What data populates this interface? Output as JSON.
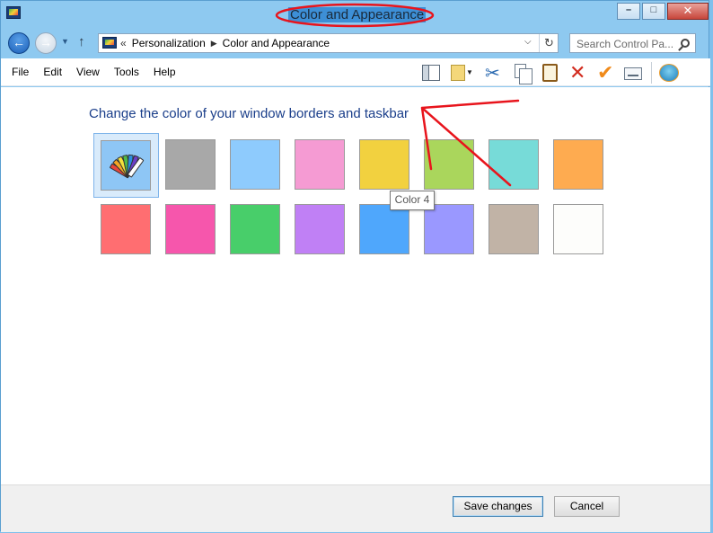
{
  "window": {
    "title": "Color and Appearance",
    "caption_buttons": {
      "minimize": "–",
      "maximize": "□",
      "close": "✕"
    }
  },
  "address_bar": {
    "back_glyph": "←",
    "forward_glyph": "→",
    "up_glyph": "↑",
    "overflow": "«",
    "breadcrumbs": [
      "Personalization",
      "Color and Appearance"
    ],
    "search_placeholder": "Search Control Pa..."
  },
  "menu": {
    "items": [
      "File",
      "Edit",
      "View",
      "Tools",
      "Help"
    ]
  },
  "toolbar": {
    "icons": [
      "preview-pane-icon",
      "organize-icon",
      "cut-icon",
      "copy-icon",
      "paste-icon",
      "delete-icon",
      "check-icon",
      "properties-icon",
      "theme-icon"
    ]
  },
  "content": {
    "heading": "Change the color of your window borders and taskbar",
    "tooltip": "Color 4",
    "swatches": [
      {
        "color": "#8ec6f5",
        "selected": true,
        "icon": "color-palette-icon"
      },
      {
        "color": "#a8a8a8"
      },
      {
        "color": "#8ecbfd"
      },
      {
        "color": "#f59bd3"
      },
      {
        "color": "#f2d13f"
      },
      {
        "color": "#aad65c"
      },
      {
        "color": "#77dbd8"
      },
      {
        "color": "#feab50"
      },
      {
        "color": "#ff6e71"
      },
      {
        "color": "#f656ac"
      },
      {
        "color": "#48ce6a"
      },
      {
        "color": "#c080f5"
      },
      {
        "color": "#4fa7fc"
      },
      {
        "color": "#9a98ff"
      },
      {
        "color": "#c1b3a6"
      },
      {
        "color": "#fdfdfb"
      }
    ]
  },
  "footer": {
    "save_label": "Save changes",
    "cancel_label": "Cancel"
  },
  "colors": {
    "annotation": "#e8141c",
    "heading": "#1a3e8a"
  }
}
